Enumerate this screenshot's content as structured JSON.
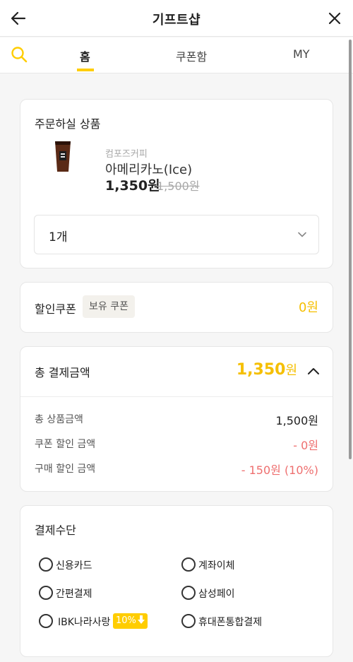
{
  "header": {
    "title": "기프트샵"
  },
  "tabs": [
    "홈",
    "쿠폰함",
    "MY"
  ],
  "order": {
    "section_title": "주문하실 상품",
    "brand": "컴포즈커피",
    "product_name": "아메리카노(Ice)",
    "price": "1,350원",
    "original_price": "1,500원",
    "quantity": "1개"
  },
  "coupon": {
    "label": "할인쿠폰",
    "badge": "보유 쿠폰",
    "amount": "0원"
  },
  "total": {
    "label": "총 결제금액",
    "amount": "1,350",
    "unit": "원",
    "rows": [
      {
        "label": "총 상품금액",
        "value": "1,500원"
      },
      {
        "label": "쿠폰 할인 금액",
        "value": "- 0원"
      },
      {
        "label": "구매 할인 금액",
        "value": "- 150원 (10%)"
      }
    ]
  },
  "payment": {
    "title": "결제수단",
    "options": [
      "신용카드",
      "계좌이체",
      "간편결제",
      "삼성페이",
      "IBK나라사랑",
      "휴대폰통합결제"
    ],
    "promo": "10%"
  },
  "colors": {
    "accent": "#ffcd00",
    "discount": "#ee6f6f"
  }
}
